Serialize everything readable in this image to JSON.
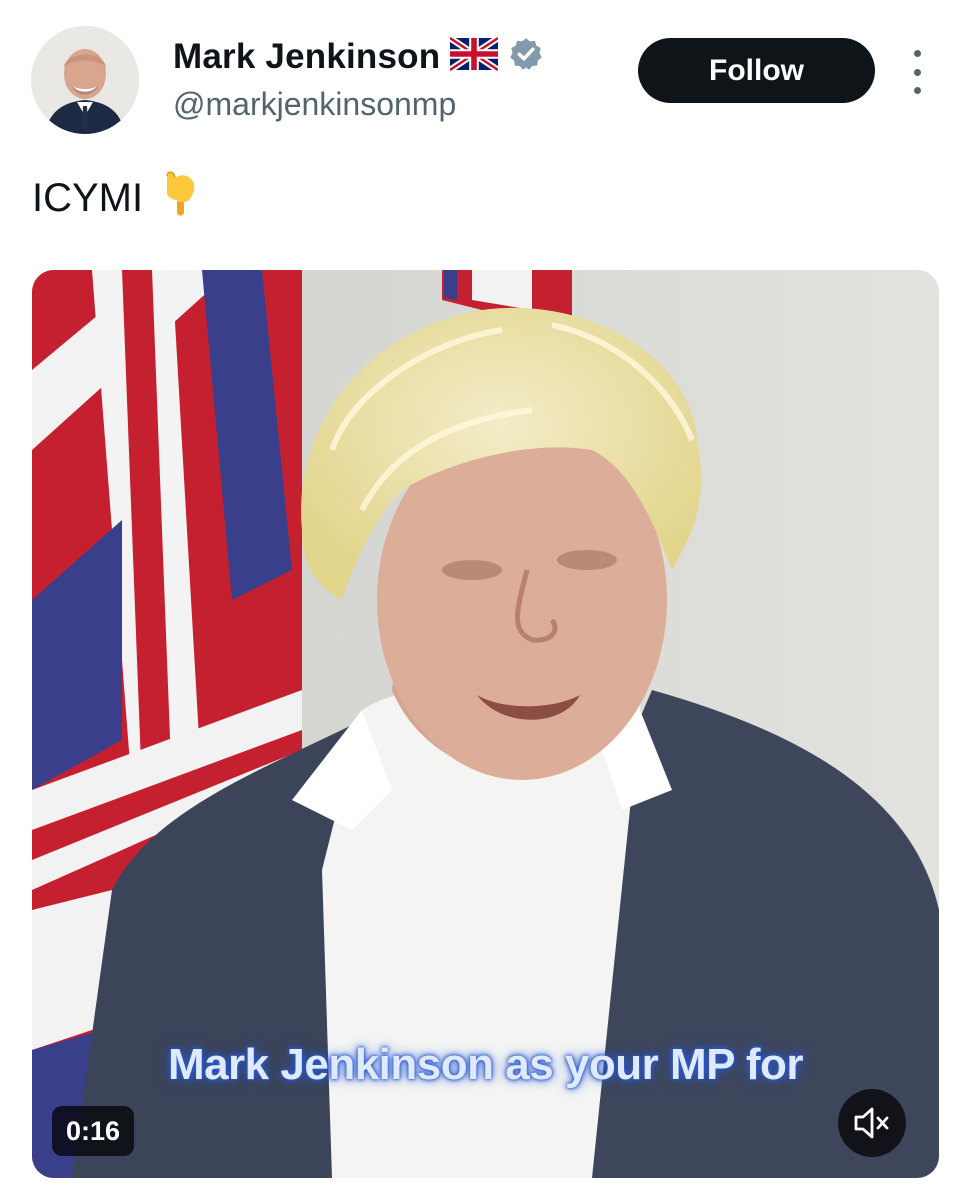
{
  "author": {
    "display_name": "Mark Jenkinson",
    "handle": "@markjenkinsonmp",
    "flag_emoji": "🇬🇧",
    "verified": true,
    "verified_color": "#829aab",
    "avatar_icon": "avatar"
  },
  "actions": {
    "follow_label": "Follow",
    "more_icon": "more-vertical-icon"
  },
  "tweet": {
    "text": "ICYMI",
    "emoji": "👇"
  },
  "media": {
    "type": "video",
    "subtitle": "Mark Jenkinson as your MP for",
    "duration": "0:16",
    "muted": true,
    "mute_icon": "speaker-muted-icon"
  }
}
